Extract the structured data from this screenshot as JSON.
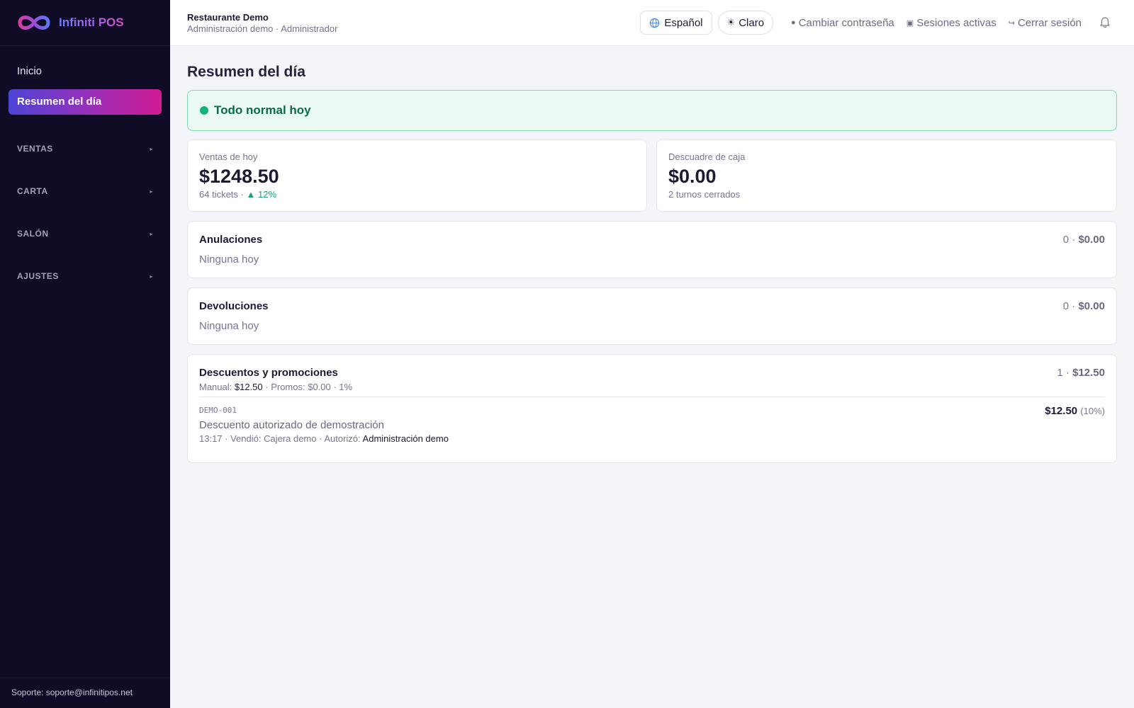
{
  "app": {
    "brand_name": "Infiniti POS",
    "support_text": "Soporte: soporte@infinitipos.net"
  },
  "sidebar": {
    "home_label": "Inicio",
    "active_label": "Resumen del día",
    "sections": [
      {
        "label": "VENTAS"
      },
      {
        "label": "CARTA"
      },
      {
        "label": "SALÓN"
      },
      {
        "label": "AJUSTES"
      }
    ]
  },
  "topbar": {
    "restaurant_name": "Restaurante Demo",
    "user_line": "Administración demo · Administrador",
    "language_label": "Español",
    "theme_label": "Claro",
    "change_password_label": "Cambiar contraseña",
    "sessions_label": "Sesiones activas",
    "logout_label": "Cerrar sesión"
  },
  "page": {
    "title": "Resumen del día",
    "status_text": "Todo normal hoy"
  },
  "kpis": {
    "sales": {
      "label": "Ventas de hoy",
      "value": "$1248.50",
      "tickets": "64 tickets",
      "change": "12%"
    },
    "cash": {
      "label": "Descuadre de caja",
      "value": "$0.00",
      "meta": "2 turnos cerrados"
    }
  },
  "cards": {
    "voids": {
      "title": "Anulaciones",
      "count": "0",
      "amount": "$0.00",
      "empty": "Ninguna hoy"
    },
    "returns": {
      "title": "Devoluciones",
      "count": "0",
      "amount": "$0.00",
      "empty": "Ninguna hoy"
    },
    "discounts": {
      "title": "Descuentos y promociones",
      "count": "1",
      "amount": "$12.50",
      "manual_label": "Manual:",
      "manual_value": "$12.50",
      "promos_text": "· Promos: $0.00 · 1%",
      "items": [
        {
          "code": "DEMO-001",
          "description": "Descuento autorizado de demostración",
          "meta": "13:17 · Vendió: Cajera demo · Autorizó:",
          "authorizer": "Administración demo",
          "amount": "$12.50",
          "percent": "(10%)"
        }
      ]
    }
  },
  "colors": {
    "sidebar_bg": "#110c26",
    "accent_start": "#4c44d4",
    "accent_end": "#d11b95",
    "status_green": "#12b278",
    "positive": "#13a370"
  }
}
